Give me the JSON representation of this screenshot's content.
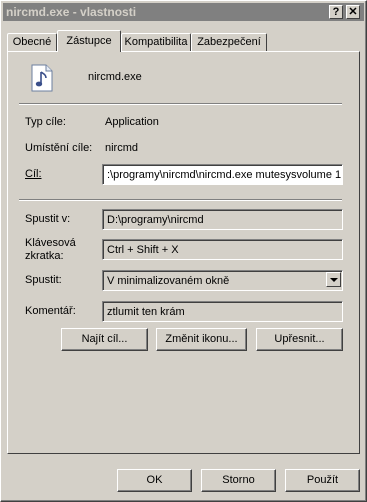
{
  "window": {
    "title": "nircmd.exe - vlastnosti",
    "help_btn": "?",
    "close_btn": "✕"
  },
  "tabs": [
    {
      "label": "Obecné"
    },
    {
      "label": "Zástupce"
    },
    {
      "label": "Kompatibilita"
    },
    {
      "label": "Zabezpečení"
    }
  ],
  "shortcut": {
    "name": "nircmd.exe",
    "target_type_label": "Typ cíle:",
    "target_type_value": "Application",
    "target_location_label": "Umístění cíle:",
    "target_location_value": "nircmd",
    "target_label": "Cíl:",
    "target_value": ":\\programy\\nircmd\\nircmd.exe mutesysvolume 1",
    "start_in_label": "Spustit v:",
    "start_in_value": "D:\\programy\\nircmd",
    "hotkey_label_1": "Klávesová",
    "hotkey_label_2": "zkratka:",
    "hotkey_value": "Ctrl + Shift + X",
    "run_label": "Spustit:",
    "run_value": "V minimalizovaném okně",
    "comment_label": "Komentář:",
    "comment_value": "ztlumit ten krám"
  },
  "buttons": {
    "find_target": "Najít cíl...",
    "change_icon": "Změnit ikonu...",
    "advanced": "Upřesnit...",
    "ok": "OK",
    "cancel": "Storno",
    "apply": "Použít"
  }
}
